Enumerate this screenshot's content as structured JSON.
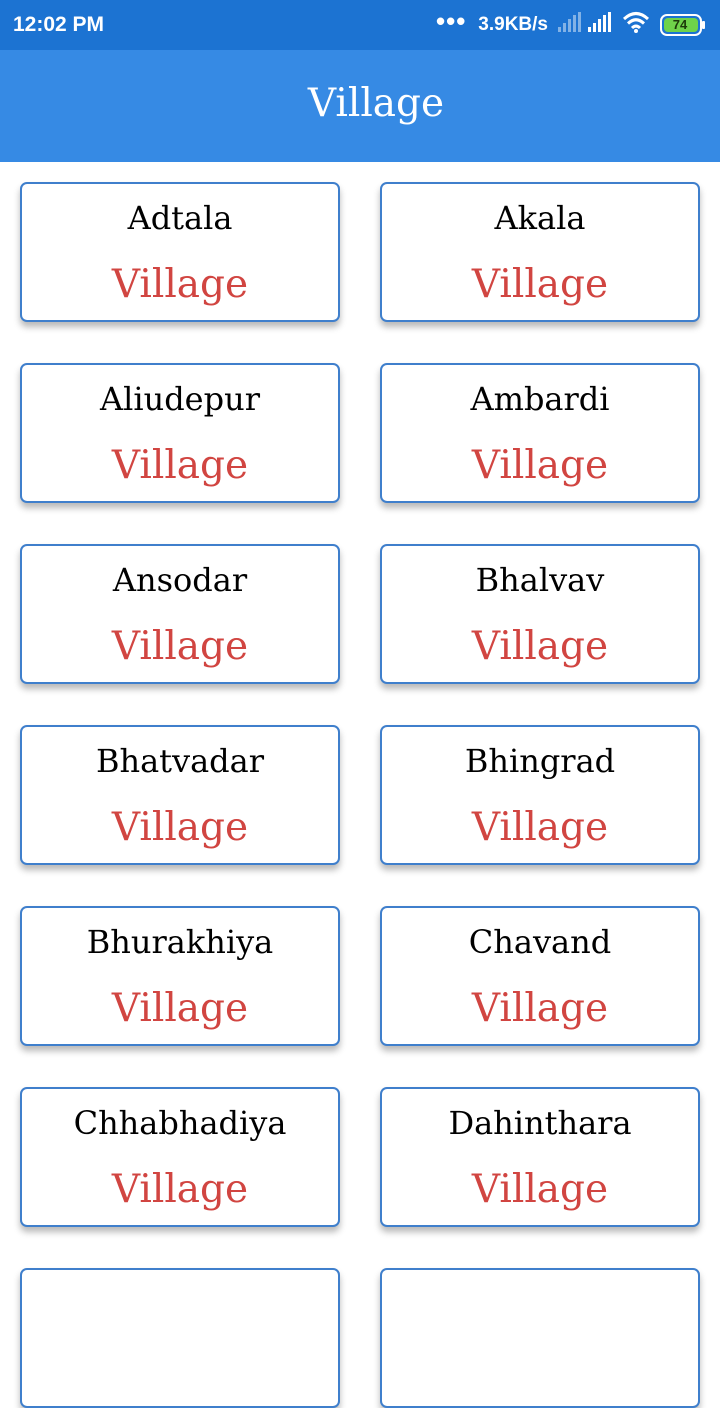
{
  "status_bar": {
    "time": "12:02 PM",
    "dots": "•••",
    "net_speed": "3.9KB/s",
    "battery": "74",
    "icons": [
      "signal-empty-icon",
      "signal-icon",
      "wifi-icon",
      "battery-icon"
    ]
  },
  "app_bar": {
    "title": "Village",
    "color": "#368ae4"
  },
  "villages": [
    {
      "name": "Adtala",
      "type": "Village"
    },
    {
      "name": "Akala",
      "type": "Village"
    },
    {
      "name": "Aliudepur",
      "type": "Village"
    },
    {
      "name": "Ambardi",
      "type": "Village"
    },
    {
      "name": "Ansodar",
      "type": "Village"
    },
    {
      "name": "Bhalvav",
      "type": "Village"
    },
    {
      "name": "Bhatvadar",
      "type": "Village"
    },
    {
      "name": "Bhingrad",
      "type": "Village"
    },
    {
      "name": "Bhurakhiya",
      "type": "Village"
    },
    {
      "name": "Chavand",
      "type": "Village"
    },
    {
      "name": "Chhabhadiya",
      "type": "Village"
    },
    {
      "name": "Dahinthara",
      "type": "Village"
    },
    {
      "name": "",
      "type": ""
    },
    {
      "name": "",
      "type": ""
    }
  ],
  "colors": {
    "status_bar": "#1c73d2",
    "card_border": "#3f7fcc",
    "village_label": "#d14541"
  }
}
